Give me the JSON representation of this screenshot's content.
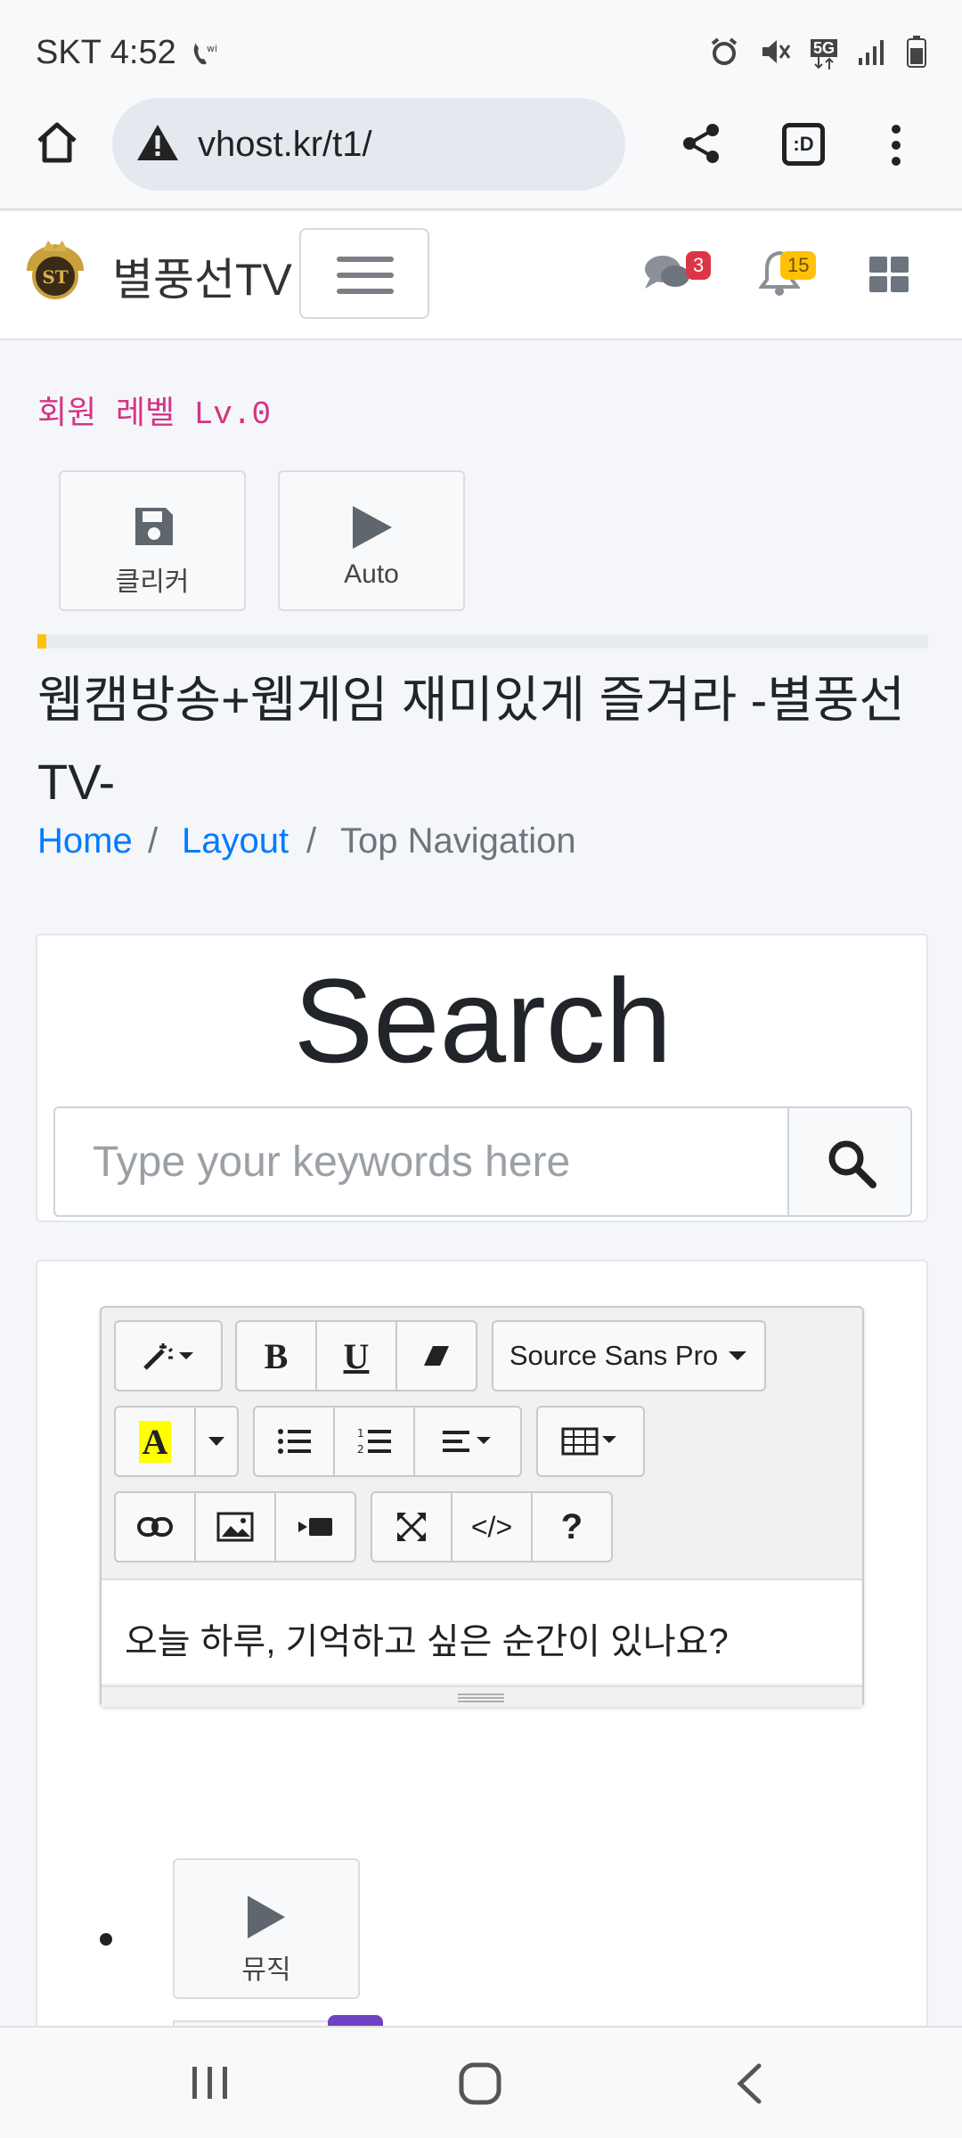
{
  "status_bar": {
    "carrier_time": "SKT 4:52",
    "network": "5G"
  },
  "browser": {
    "url": "vhost.kr/t1/",
    "tab_badge": ":D"
  },
  "navbar": {
    "brand": "별풍선TV",
    "messages_count": "3",
    "notifications_count": "15"
  },
  "member_level": "회원 레벨 Lv.0",
  "tools": {
    "clicker_label": "클리커",
    "auto_label": "Auto"
  },
  "progress_percent": 1,
  "page_title": "웹캠방송+웹게임 재미있게 즐겨라 -별풍선TV-",
  "breadcrumb": {
    "home": "Home",
    "layout": "Layout",
    "current": "Top Navigation",
    "separator": "/"
  },
  "search": {
    "title": "Search",
    "placeholder": "Type your keywords here"
  },
  "editor": {
    "font_name": "Source Sans Pro",
    "content": "오늘 하루, 기억하고 싶은 순간이 있나요?",
    "code_label": "</>",
    "help_label": "?",
    "bold_label": "B",
    "underline_label": "U",
    "color_label": "A"
  },
  "list": {
    "music_label": "뮤직"
  },
  "colors": {
    "accent_pink": "#d63384",
    "link_blue": "#007bff",
    "badge_red": "#dc3545",
    "badge_yellow": "#ffc107",
    "progress_yellow": "#ffc107"
  }
}
